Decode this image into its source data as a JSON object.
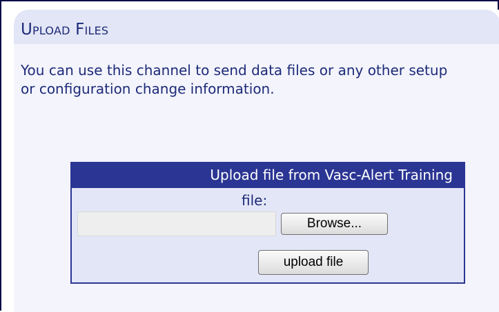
{
  "panel": {
    "title": "Upload Files",
    "intro": "You can use this channel to send data files or any other setup or configuration change information."
  },
  "upload_form": {
    "header": "Upload file from Vasc-Alert Training",
    "file_label": "file:",
    "file_value": "",
    "browse_label": "Browse...",
    "submit_label": "upload file"
  },
  "colors": {
    "header_band": "#2b3593",
    "panel_tint": "#e3e6f6",
    "text": "#1d2a78"
  }
}
